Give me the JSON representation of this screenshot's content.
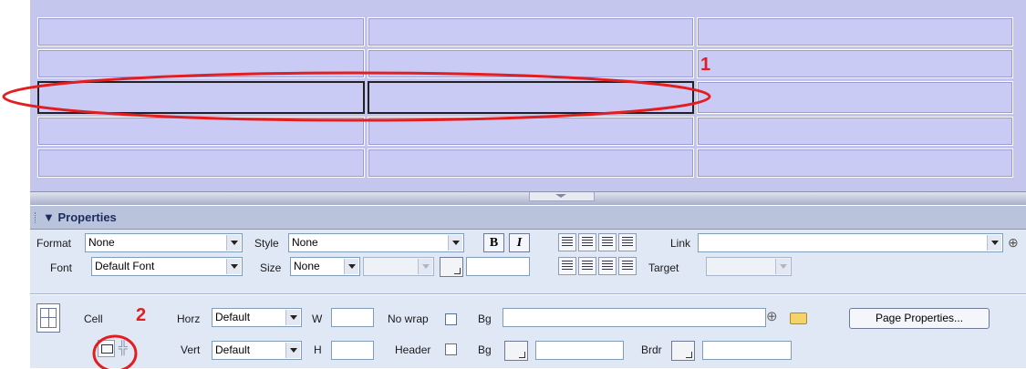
{
  "annotations": {
    "marker_1": "1",
    "marker_2": "2"
  },
  "properties_panel": {
    "title": "Properties",
    "format": {
      "label": "Format",
      "value": "None"
    },
    "style": {
      "label": "Style",
      "value": "None"
    },
    "bold_label": "B",
    "italic_label": "I",
    "link_label": "Link",
    "link_value": "",
    "font": {
      "label": "Font",
      "value": "Default Font"
    },
    "size": {
      "label": "Size",
      "value": "None"
    },
    "target_label": "Target",
    "cell_label": "Cell",
    "horz": {
      "label": "Horz",
      "value": "Default"
    },
    "vert": {
      "label": "Vert",
      "value": "Default"
    },
    "w_label": "W",
    "h_label": "H",
    "nowrap_label": "No wrap",
    "header_label": "Header",
    "bg_label": "Bg",
    "bg2_label": "Bg",
    "brdr_label": "Brdr",
    "page_properties_button": "Page Properties...",
    "icons": [
      "table-cell-icon",
      "merge-cells-icon",
      "split-cell-icon",
      "point-to-file-icon",
      "folder-icon"
    ]
  },
  "colors": {
    "design_bg": "#c4c6ee",
    "cell_bg": "#cacbf5",
    "panel_bg": "#e1e8f5",
    "annotation": "#e41e20"
  }
}
